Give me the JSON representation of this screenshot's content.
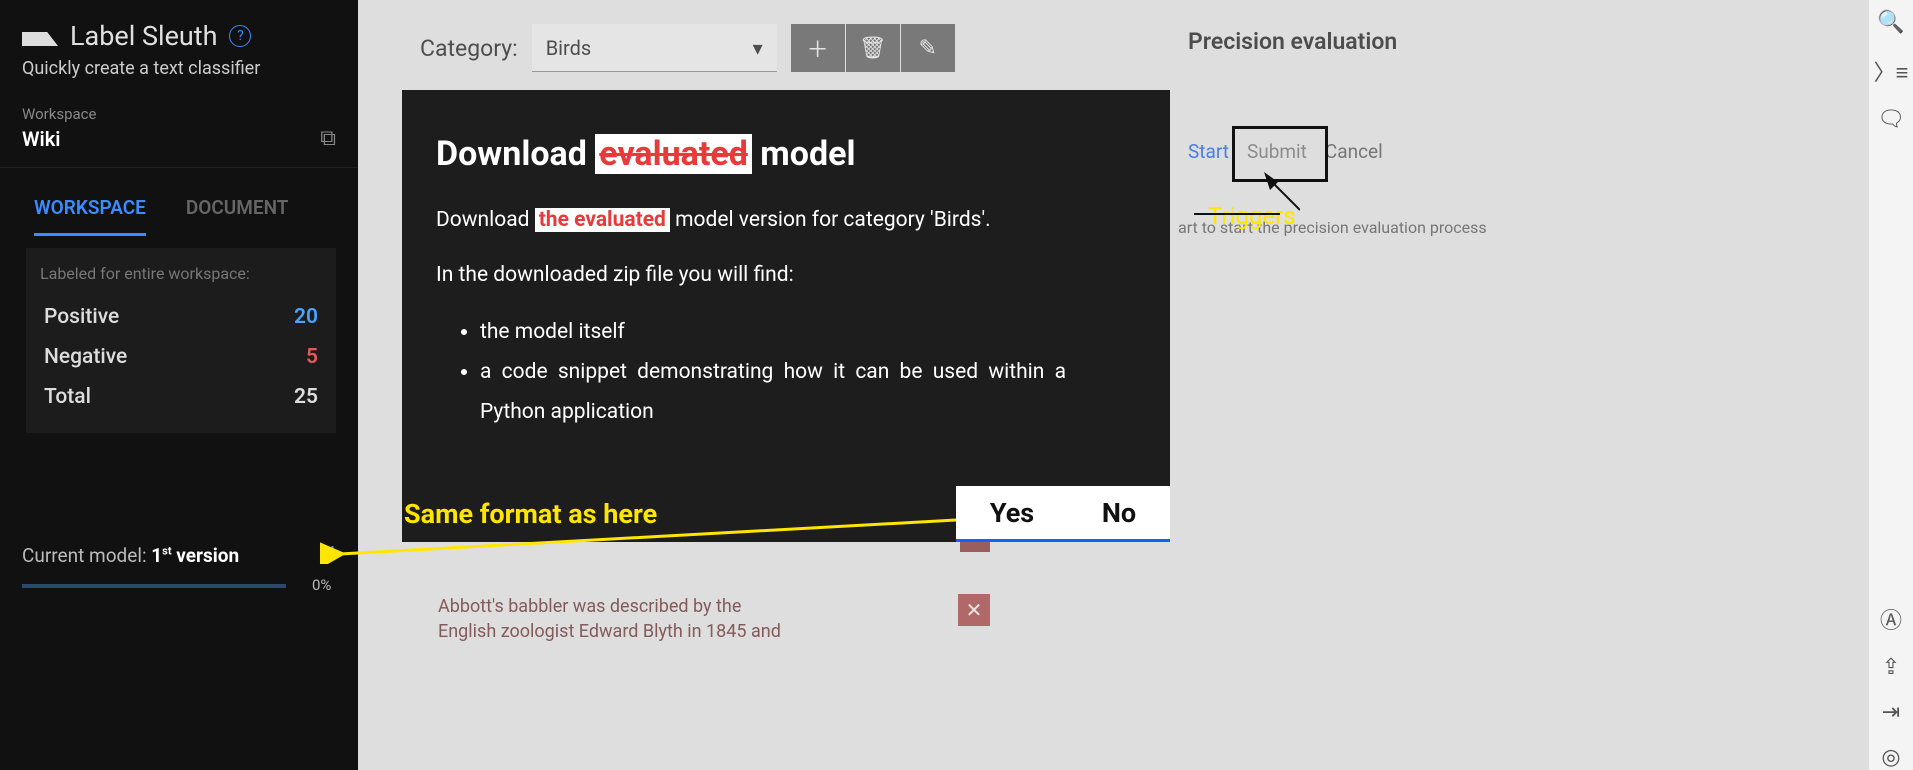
{
  "app": {
    "title": "Label Sleuth",
    "tagline": "Quickly create a text classifier"
  },
  "workspace": {
    "label": "Workspace",
    "name": "Wiki"
  },
  "tabs": {
    "workspace": "WORKSPACE",
    "document": "DOCUMENT"
  },
  "stats": {
    "heading": "Labeled for entire workspace:",
    "positive_label": "Positive",
    "positive_value": "20",
    "negative_label": "Negative",
    "negative_value": "5",
    "total_label": "Total",
    "total_value": "25"
  },
  "model": {
    "prefix": "Current model: ",
    "version_num": "1",
    "ord": "st",
    "suffix": " version",
    "progress": "0%"
  },
  "category": {
    "label": "Category:",
    "selected": "Birds"
  },
  "precision": {
    "title": "Precision evaluation",
    "start": "Start",
    "submit": "Submit",
    "cancel": "Cancel",
    "hint": "art to start the precision evaluation process"
  },
  "doc": {
    "line1": "Abbott's babbler was described by the",
    "line2": "English zoologist Edward Blyth in 1845 and"
  },
  "modal": {
    "title_a": "Download ",
    "title_hl": "evaluated",
    "title_b": " model",
    "p1_a": "Download ",
    "p1_hl": "the evaluated",
    "p1_b": " model version for category 'Birds'.",
    "p2": "In the downloaded zip file you will find:",
    "li1": "the model itself",
    "li2": "a code snippet demonstrating how it can be used within a Python application",
    "yes": "Yes",
    "no": "No"
  },
  "ann": {
    "triggers": "Triggers",
    "same": "Same format as here"
  }
}
